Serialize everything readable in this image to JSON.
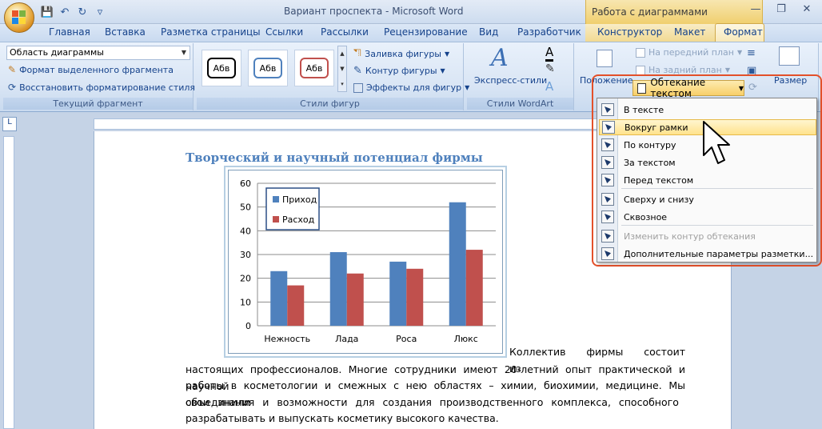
{
  "window": {
    "title": "Вариант проспекта - Microsoft Word",
    "tool_group_title": "Работа с диаграммами"
  },
  "tabs": [
    "Главная",
    "Вставка",
    "Разметка страницы",
    "Ссылки",
    "Рассылки",
    "Рецензирование",
    "Вид",
    "Разработчик",
    "Конструктор",
    "Макет",
    "Формат"
  ],
  "ribbon": {
    "current_fragment": {
      "selector_value": "Область диаграммы",
      "format_selection": "Формат выделенного фрагмента",
      "reset_style": "Восстановить форматирование стиля",
      "label": "Текущий фрагмент"
    },
    "shape_styles": {
      "sample": "Абв",
      "fill": "Заливка фигуры",
      "outline": "Контур фигуры",
      "effects": "Эффекты для фигур",
      "label": "Стили фигур"
    },
    "wordart": {
      "express": "Экспресс-стили",
      "label": "Стили WordArt"
    },
    "arrange": {
      "position": "Положение",
      "bring_front": "На передний план",
      "send_back": "На задний план",
      "wrap_text": "Обтекание текстом",
      "size": "Размер"
    }
  },
  "wrap_menu": {
    "items": [
      "В тексте",
      "Вокруг рамки",
      "По контуру",
      "За текстом",
      "Перед текстом",
      "Сверху и снизу",
      "Сквозное",
      "Изменить контур обтекания",
      "Дополнительные параметры разметки..."
    ],
    "highlighted_index": 1,
    "disabled_index": 7
  },
  "document": {
    "heading": "Творческий и научный потенциал фирмы",
    "para_line1": "Коллектив фирмы состоит из",
    "para_rest": [
      "настоящих профессионалов. Многие сотрудники имеют 20-летний опыт практической и научной",
      "работы в косметологии и смежных с нею областях – химии, биохимии, медицине. Мы объединили",
      "свои знания и возможности для создания производственного комплекса, способного",
      "разрабатывать и выпускать косметику высокого качества."
    ]
  },
  "chart_data": {
    "type": "bar",
    "categories": [
      "Нежность",
      "Лада",
      "Роса",
      "Люкс"
    ],
    "series": [
      {
        "name": "Приход",
        "values": [
          23,
          31,
          27,
          52
        ],
        "color": "#4f81bd"
      },
      {
        "name": "Расход",
        "values": [
          17,
          22,
          24,
          32
        ],
        "color": "#c0504d"
      }
    ],
    "ylim": [
      0,
      60
    ],
    "yticks": [
      0,
      10,
      20,
      30,
      40,
      50,
      60
    ],
    "grid": true,
    "legend": "top-left"
  }
}
